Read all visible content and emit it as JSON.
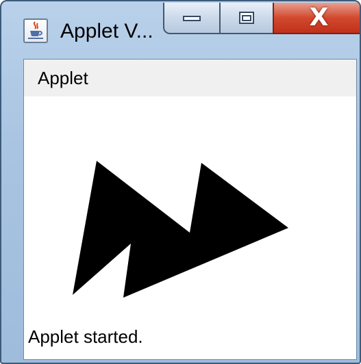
{
  "window": {
    "title": "Applet V...",
    "close_glyph": "X",
    "controls": [
      "minimize-button",
      "maximize-button",
      "close-button"
    ]
  },
  "menu": {
    "items": [
      {
        "label": "Applet"
      }
    ]
  },
  "status": {
    "text": "Applet started."
  },
  "colors": {
    "shape_fill": "#000000",
    "menubar_bg": "#f0f0f0",
    "close_button": "#c83a20",
    "window_frame": "#a9c4e2"
  },
  "icons": [
    "java-cup-icon",
    "minimize-icon",
    "maximize-icon",
    "close-icon"
  ]
}
